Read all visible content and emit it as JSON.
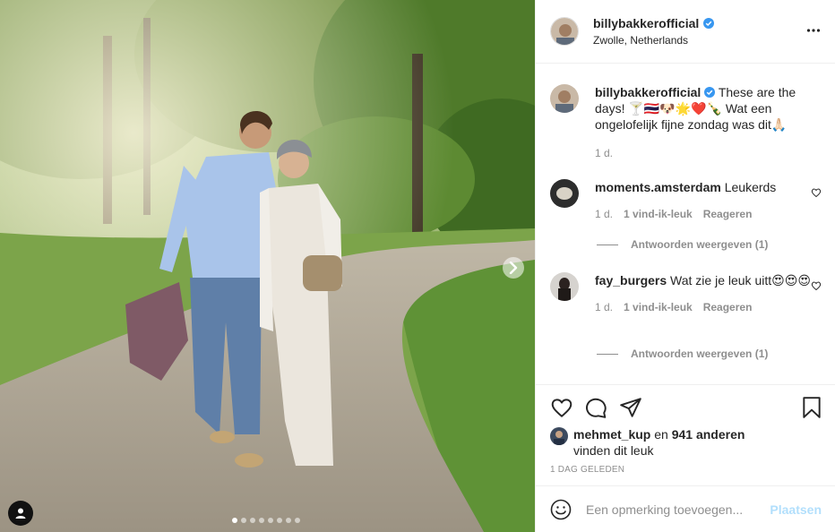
{
  "post": {
    "username": "billybakkerofficial",
    "location": "Zwolle, Netherlands",
    "verified": true
  },
  "caption": {
    "username": "billybakkerofficial",
    "text": "These are the days! 🍸🇹🇭🐶🌟❤️🍾 Wat een ongelofelijk fijne zondag was dit🙏🏻",
    "time": "1 d."
  },
  "comments": [
    {
      "username": "moments.amsterdam",
      "text": "Leukerds",
      "time": "1 d.",
      "likes": "1 vind-ik-leuk",
      "reply": "Reageren",
      "view_replies": "Antwoorden weergeven (1)"
    },
    {
      "username": "fay_burgers",
      "text": "Wat zie je leuk uitt😍😍😍",
      "time": "1 d.",
      "likes": "1 vind-ik-leuk",
      "reply": "Reageren",
      "view_replies": "Antwoorden weergeven (1)"
    }
  ],
  "likes": {
    "first_user": "mehmet_kup",
    "joiner": "en",
    "others": "941 anderen",
    "suffix": "vinden dit leuk"
  },
  "timestamp": "1 DAG GELEDEN",
  "add_comment": {
    "placeholder": "Een opmerking toevoegen...",
    "post_label": "Plaatsen"
  },
  "carousel": {
    "slides": 8,
    "active": 1
  },
  "icons": {
    "more": "more-horizontal-icon",
    "verified": "verified-badge-icon",
    "like": "heart-icon",
    "comment": "comment-icon",
    "share": "paper-plane-icon",
    "save": "bookmark-icon",
    "emoji": "smiley-icon",
    "next": "chevron-right-icon",
    "tags": "user-tag-icon"
  },
  "colors": {
    "verified": "#3897f0",
    "muted": "#8e8e8e",
    "post_disabled": "#b2dffc",
    "border": "#efefef"
  }
}
